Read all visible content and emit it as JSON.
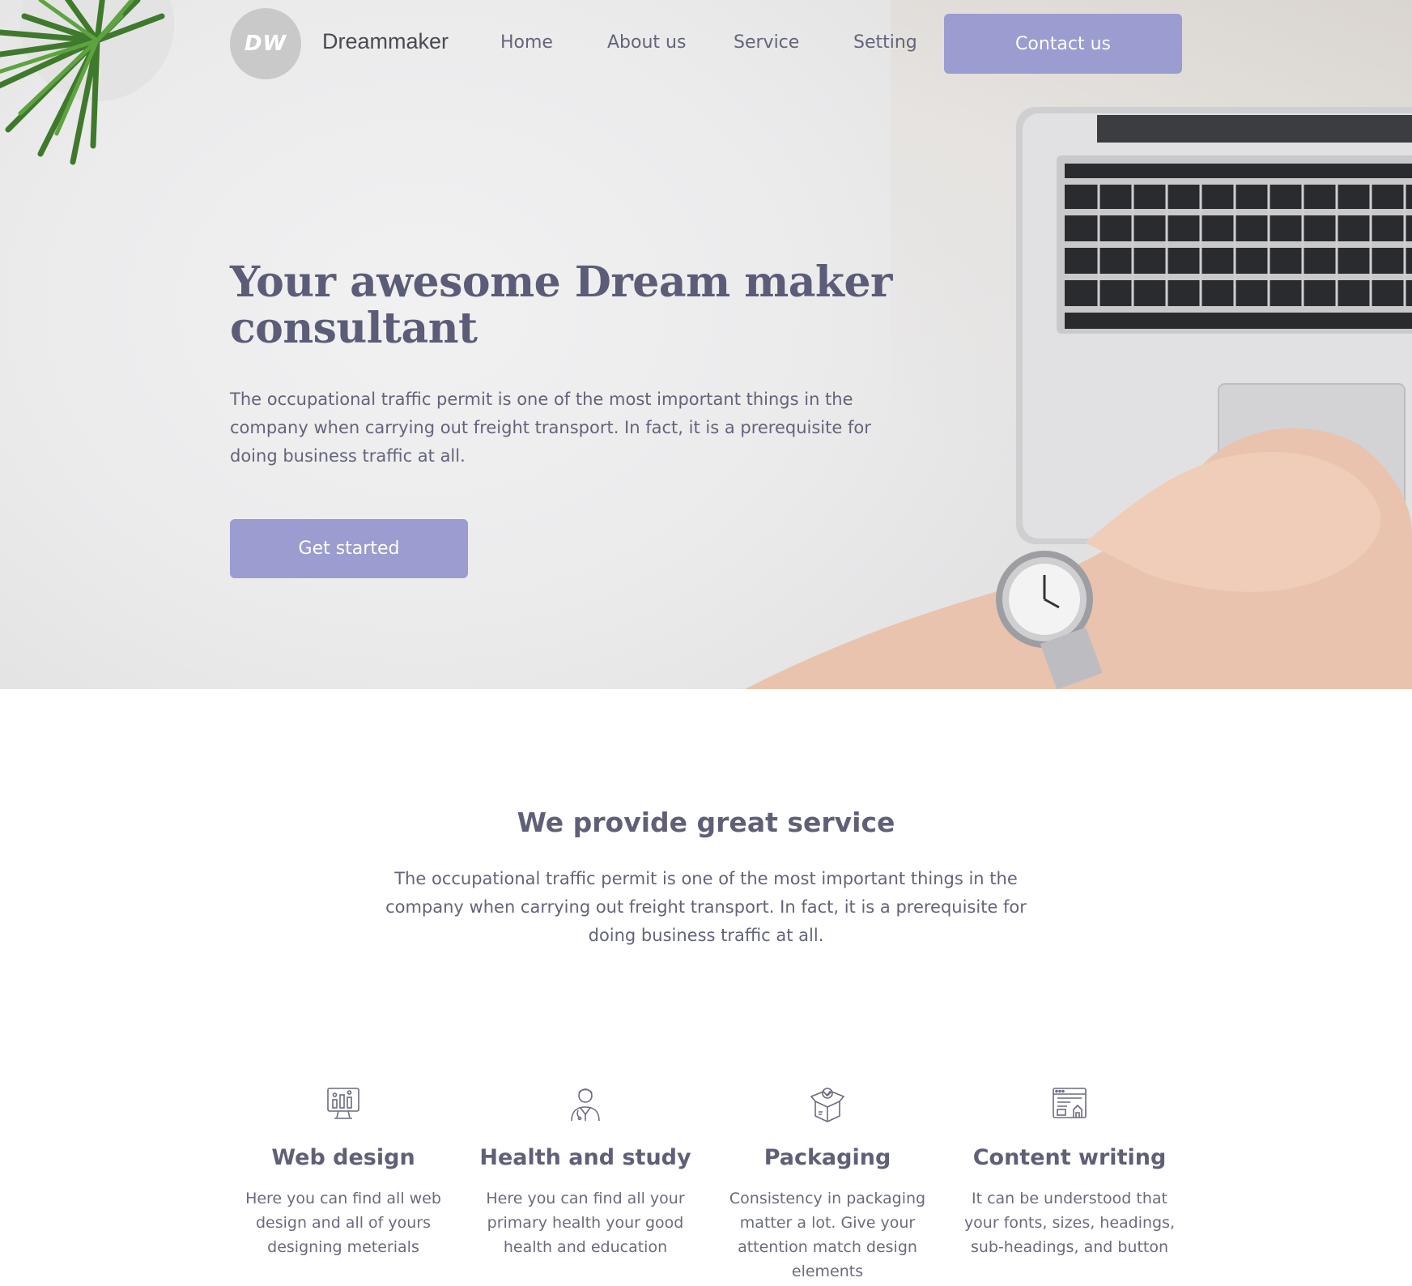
{
  "header": {
    "logo_text": "DW",
    "brand": "Dreammaker",
    "nav": [
      "Home",
      "About us",
      "Service",
      "Setting"
    ],
    "contact_label": "Contact us"
  },
  "hero": {
    "title": "Your awesome Dream maker consultant",
    "text": "The occupational traffic permit is one of the most important things in the company when carrying out freight transport. In fact, it is a prerequisite for doing business traffic at all.",
    "cta_label": "Get started"
  },
  "services": {
    "title": "We provide great service",
    "text": "The occupational traffic permit is one of the most important things in the company when carrying out freight transport. In fact, it is a prerequisite for doing business traffic at all.",
    "cards": [
      {
        "icon": "monitor-chart-icon",
        "title": "Web design",
        "text": "Here you can find all web design and all of yours designing meterials"
      },
      {
        "icon": "doctor-icon",
        "title": "Health and study",
        "text": "Here you can find all your primary health your good health and education"
      },
      {
        "icon": "package-box-icon",
        "title": "Packaging",
        "text": "Consistency in packaging matter a lot. Give your attention match design elements"
      },
      {
        "icon": "content-layout-icon",
        "title": "Content writing",
        "text": "It can be understood that your fonts, sizes, headings, sub-headings, and button"
      }
    ]
  },
  "colors": {
    "accent": "#9b9ccf",
    "heading": "#5b5c77",
    "text": "#63647a"
  }
}
